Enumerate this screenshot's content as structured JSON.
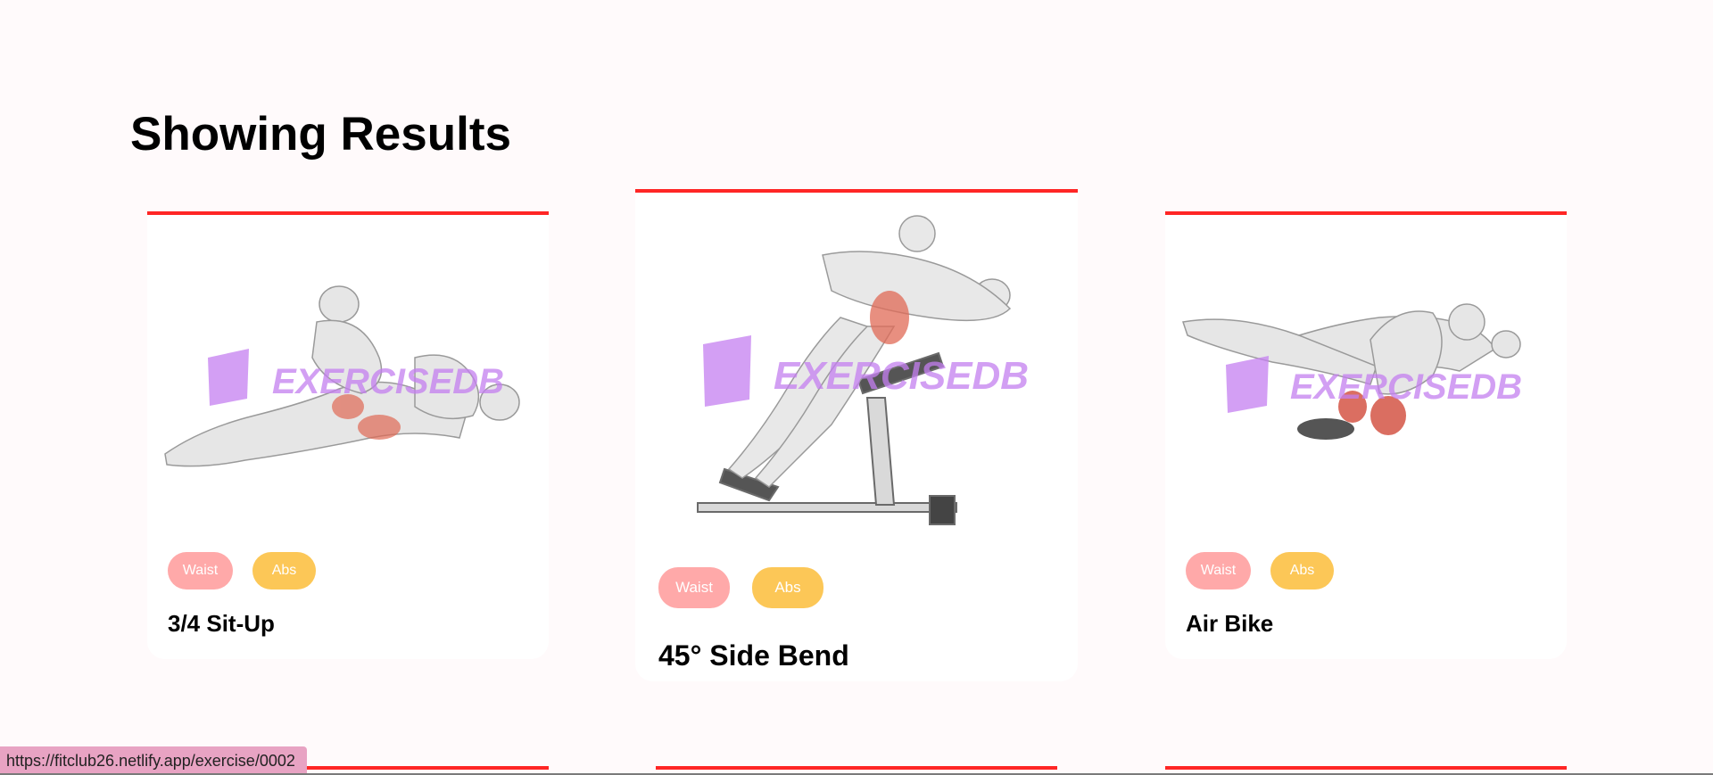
{
  "heading": "Showing Results",
  "exercises": [
    {
      "name": "3/4 Sit-Up",
      "body_part": "Waist",
      "target": "Abs",
      "watermark": "EXERCISEDB"
    },
    {
      "name": "45° Side Bend",
      "body_part": "Waist",
      "target": "Abs",
      "watermark": "EXERCISEDB"
    },
    {
      "name": "Air Bike",
      "body_part": "Waist",
      "target": "Abs",
      "watermark": "EXERCISEDB"
    }
  ],
  "status_url": "https://fitclub26.netlify.app/exercise/0002",
  "colors": {
    "accent": "#ff2625",
    "body_part_pill": "#ffa9a9",
    "target_pill": "#fcc757",
    "watermark": "#c47ff0",
    "background": "#fffafb"
  }
}
